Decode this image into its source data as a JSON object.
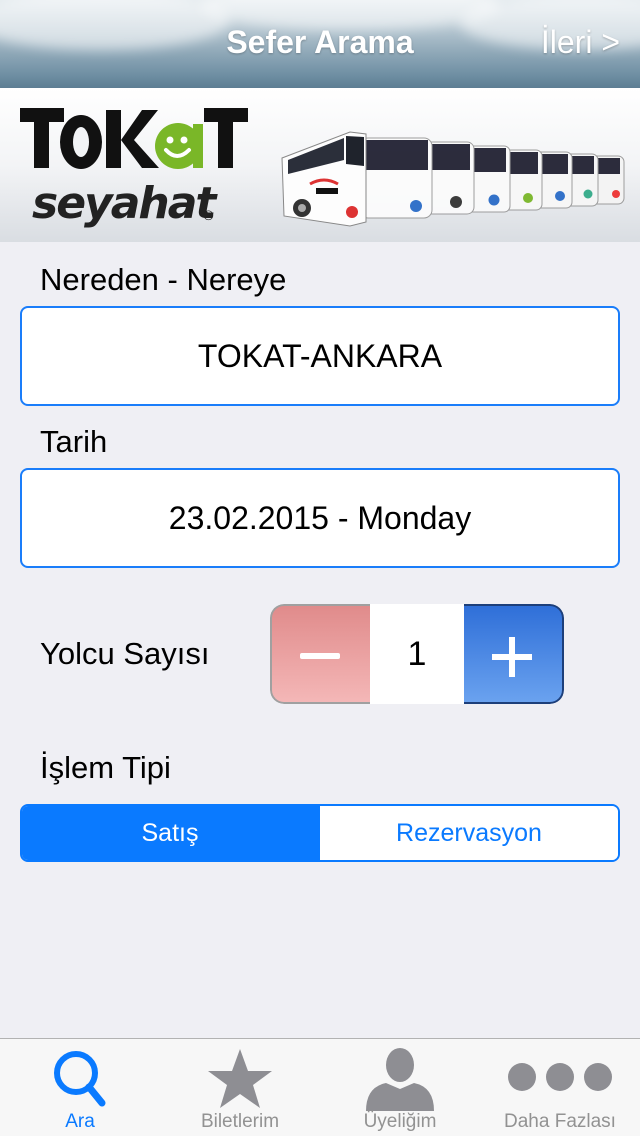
{
  "nav": {
    "title": "Sefer Arama",
    "forward_label": "İleri >"
  },
  "banner": {
    "logo_top": "TOKAT",
    "logo_bottom": "seyahat",
    "logo_mark": "®"
  },
  "route": {
    "label": "Nereden - Nereye",
    "value": "TOKAT-ANKARA"
  },
  "date": {
    "label": "Tarih",
    "value": "23.02.2015 - Monday"
  },
  "passengers": {
    "label": "Yolcu Sayısı",
    "count": "1",
    "minus_icon": "minus-icon",
    "plus_icon": "plus-icon"
  },
  "transaction": {
    "label": "İşlem Tipi",
    "options": [
      "Satış",
      "Rezervasyon"
    ],
    "selected": "Satış"
  },
  "tabbar": {
    "items": [
      {
        "label": "Ara",
        "icon": "search-icon",
        "active": true
      },
      {
        "label": "Biletlerim",
        "icon": "star-icon",
        "active": false
      },
      {
        "label": "Üyeliğim",
        "icon": "person-icon",
        "active": false
      },
      {
        "label": "Daha Fazlası",
        "icon": "more-icon",
        "active": false
      }
    ]
  },
  "colors": {
    "accent": "#0a7aff",
    "field_border": "#1a7dfa",
    "minus_bg": "#f4b7b7",
    "plus_bg": "#3a7be0",
    "logo_green": "#7ab728"
  }
}
